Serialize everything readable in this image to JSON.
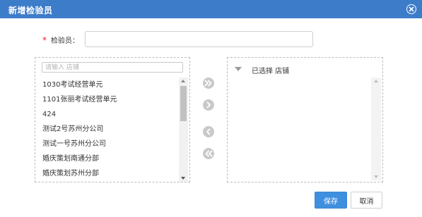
{
  "dialog": {
    "title": "新增检验员"
  },
  "form": {
    "required_mark": "*",
    "inspector_label": "检验员：",
    "inspector_value": ""
  },
  "left_panel": {
    "search_placeholder": "请输入 店铺",
    "items": [
      {
        "label": "1030考试经营单元"
      },
      {
        "label": "1101张丽考试经营单元"
      },
      {
        "label": "424"
      },
      {
        "label": "测试2号苏州分公司"
      },
      {
        "label": "测试一号苏州分公司"
      },
      {
        "label": "婚庆策划南通分部"
      },
      {
        "label": "婚庆策划苏州分部"
      }
    ]
  },
  "right_panel": {
    "selected_header": "已选择 店铺",
    "items": []
  },
  "transfer_buttons": {
    "add_all_icon": "double-chevron-right-icon",
    "add_icon": "chevron-right-icon",
    "remove_icon": "chevron-left-icon",
    "remove_all_icon": "double-chevron-left-icon"
  },
  "actions": {
    "save_label": "保存",
    "cancel_label": "取消"
  },
  "colors": {
    "titlebar": "#3d7cc9",
    "primary_button": "#3f8fdf",
    "required": "#e02020"
  }
}
